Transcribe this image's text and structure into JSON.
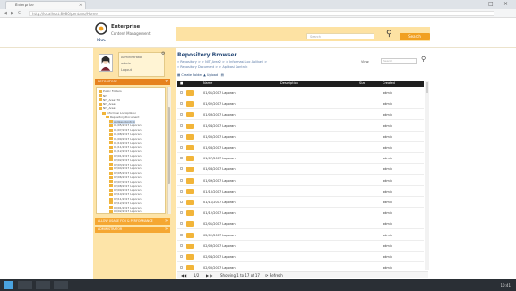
{
  "browser": {
    "tab_title": "Enterprise",
    "tab_close": "×",
    "address": "http://localhost:8080/pentaho/Home",
    "window_controls": [
      "—",
      "□",
      "×"
    ],
    "nav_buttons": [
      "◀",
      "▶",
      "C"
    ]
  },
  "header": {
    "brand_title": "Enterprise",
    "brand_subtitle": "Content Management",
    "search_placeholder": "Search",
    "go_button": "Search"
  },
  "sidebar": {
    "user_lines": [
      "Administrator",
      "admin",
      "Logout"
    ],
    "user_badge": "⚙",
    "repo_section": "REPOSITORY",
    "tree": [
      {
        "label": "Public Folders",
        "indent": 0
      },
      {
        "label": "NIT",
        "indent": 0
      },
      {
        "label": "NIT_Area770",
        "indent": 0
      },
      {
        "label": "NIT_Area2",
        "indent": 0
      },
      {
        "label": "NIT_Area3",
        "indent": 0
      },
      {
        "label": "Informasi Loc Aplikasi",
        "indent": 1
      },
      {
        "label": "Repository Document",
        "indent": 2
      },
      {
        "label": "Aplikasi Kontrak",
        "indent": 3
      },
      {
        "label": "01/05/2017 Laporan",
        "indent": 3
      },
      {
        "label": "01/07/2017 Laporan",
        "indent": 3
      },
      {
        "label": "01/08/2017 Laporan",
        "indent": 3
      },
      {
        "label": "01/09/2017 Laporan",
        "indent": 3
      },
      {
        "label": "01/10/2017 Laporan",
        "indent": 3
      },
      {
        "label": "01/11/2017 Laporan",
        "indent": 3
      },
      {
        "label": "01/12/2017 Laporan",
        "indent": 3
      },
      {
        "label": "02/01/2017 Laporan",
        "indent": 3
      },
      {
        "label": "02/02/2017 Laporan",
        "indent": 3
      },
      {
        "label": "02/03/2017 Laporan",
        "indent": 3
      },
      {
        "label": "02/04/2017 Laporan",
        "indent": 3
      },
      {
        "label": "02/05/2017 Laporan",
        "indent": 3
      },
      {
        "label": "02/06/2017 Laporan",
        "indent": 3
      },
      {
        "label": "02/07/2017 Laporan",
        "indent": 3
      },
      {
        "label": "02/08/2017 Laporan",
        "indent": 3
      },
      {
        "label": "02/09/2017 Laporan",
        "indent": 3
      },
      {
        "label": "02/10/2017 Laporan",
        "indent": 3
      },
      {
        "label": "02/11/2017 Laporan",
        "indent": 3
      },
      {
        "label": "02/12/2017 Laporan",
        "indent": 3
      },
      {
        "label": "03/01/2017 Laporan",
        "indent": 3
      },
      {
        "label": "03/02/2017 Laporan",
        "indent": 3
      }
    ],
    "accordions": [
      "ALLOW USAGE FOR & PERFORMANCE",
      "ADMINISTRATOR"
    ],
    "arrow": "»"
  },
  "main": {
    "title": "Repository Browser",
    "breadcrumb1": "» Repository > > NIT_Area2 > > Informasi Loc Aplikasi >",
    "breadcrumb2": "» Repository Document > > Aplikasi Kontrak",
    "view_label": "View:",
    "filter_placeholder": "Search",
    "toolbar": "▦ Create Folder  ▲ Upload  | ▤",
    "columns": [
      "Name",
      "Description",
      "Size",
      "Created"
    ],
    "rows": [
      {
        "name": "01/01/2017 Laporan",
        "owner": "admin"
      },
      {
        "name": "01/02/2017 Laporan",
        "owner": "admin"
      },
      {
        "name": "01/03/2017 Laporan",
        "owner": "admin"
      },
      {
        "name": "01/04/2017 Laporan",
        "owner": "admin"
      },
      {
        "name": "01/05/2017 Laporan",
        "owner": "admin"
      },
      {
        "name": "01/06/2017 Laporan",
        "owner": "admin"
      },
      {
        "name": "01/07/2017 Laporan",
        "owner": "admin"
      },
      {
        "name": "01/08/2017 Laporan",
        "owner": "admin"
      },
      {
        "name": "01/09/2017 Laporan",
        "owner": "admin"
      },
      {
        "name": "01/10/2017 Laporan",
        "owner": "admin"
      },
      {
        "name": "01/11/2017 Laporan",
        "owner": "admin"
      },
      {
        "name": "01/12/2017 Laporan",
        "owner": "admin"
      },
      {
        "name": "02/01/2017 Laporan",
        "owner": "admin"
      },
      {
        "name": "02/02/2017 Laporan",
        "owner": "admin"
      },
      {
        "name": "02/03/2017 Laporan",
        "owner": "admin"
      },
      {
        "name": "02/04/2017 Laporan",
        "owner": "admin"
      },
      {
        "name": "02/05/2017 Laporan",
        "owner": "admin"
      }
    ],
    "pager": {
      "first": "◀◀",
      "prev": "1/2",
      "next": "▶ ▶",
      "page_info": "Showing 1 to 17 of 17",
      "refresh": "⟳ Refresh"
    }
  },
  "taskbar": {
    "clock": "10:41"
  }
}
